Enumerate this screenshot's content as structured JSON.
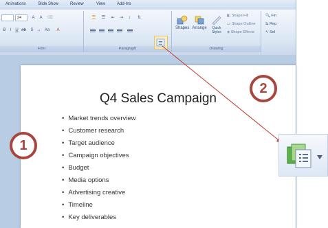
{
  "ribbon": {
    "tabs": [
      "Animations",
      "Slide Show",
      "Review",
      "View",
      "Add-Ins"
    ],
    "font_group": {
      "label": "Font",
      "size_value": "24"
    },
    "paragraph_group": {
      "label": "Paragraph"
    },
    "drawing_group": {
      "label": "Drawing",
      "shapes_label": "Shapes",
      "arrange_label": "Arrange",
      "quick_styles_label": "Quick Styles",
      "shape_fill_label": "Shape Fill",
      "shape_outline_label": "Shape Outline",
      "shape_effects_label": "Shape Effects"
    },
    "editing_items": [
      "Fin",
      "Rep",
      "Sel"
    ]
  },
  "slide": {
    "title": "Q4 Sales Campaign",
    "bullets": [
      "Market trends overview",
      "Customer research",
      "Target audience",
      "Campaign objectives",
      "Budget",
      "Media options",
      "Advertising creative",
      "Timeline",
      "Key deliverables"
    ]
  },
  "annotations": {
    "marker1": "1",
    "marker2": "2",
    "arrow_color": "#c0392b",
    "marker_color": "#a8463d"
  },
  "icons": {
    "highlighted_button": "convert-to-smartart-icon",
    "zoomed_button": "convert-to-smartart-icon"
  }
}
